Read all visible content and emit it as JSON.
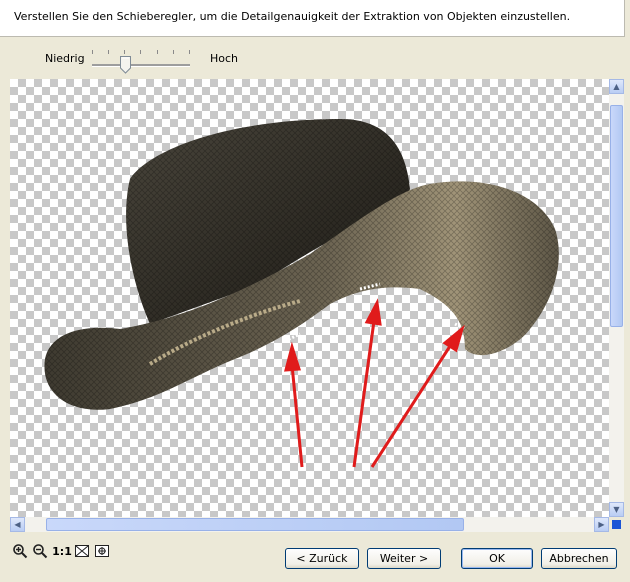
{
  "instruction": "Verstellen Sie den Schieberegler, um die Detailgenauigkeit der Extraktion von Objekten einzustellen.",
  "slider": {
    "low_label": "Niedrig",
    "high_label": "Hoch",
    "level": 0.35
  },
  "zoom": {
    "actual_size_label": "1:1"
  },
  "buttons": {
    "back": "< Zurück",
    "next": "Weiter >",
    "ok": "OK",
    "cancel": "Abbrechen"
  },
  "icons": [
    "zoom-in-icon",
    "zoom-out-icon",
    "fit-window-icon",
    "pan-icon",
    "scroll-up-arrow",
    "scroll-down-arrow",
    "scroll-left-arrow",
    "scroll-right-arrow"
  ],
  "colors": {
    "window": "#ece9d8",
    "button_border": "#003c74",
    "arrow": "#e01b1b",
    "scroll_accent": "#1a55d6"
  }
}
